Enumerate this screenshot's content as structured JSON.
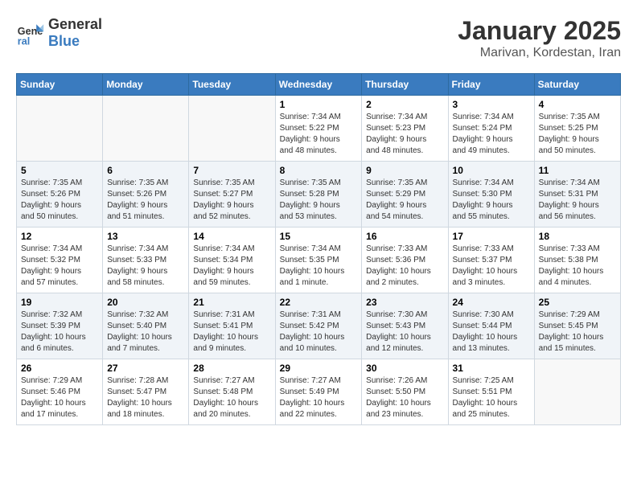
{
  "header": {
    "logo_line1": "General",
    "logo_line2": "Blue",
    "title": "January 2025",
    "subtitle": "Marivan, Kordestan, Iran"
  },
  "weekdays": [
    "Sunday",
    "Monday",
    "Tuesday",
    "Wednesday",
    "Thursday",
    "Friday",
    "Saturday"
  ],
  "weeks": [
    [
      {
        "day": null,
        "info": ""
      },
      {
        "day": null,
        "info": ""
      },
      {
        "day": null,
        "info": ""
      },
      {
        "day": "1",
        "info": "Sunrise: 7:34 AM\nSunset: 5:22 PM\nDaylight: 9 hours\nand 48 minutes."
      },
      {
        "day": "2",
        "info": "Sunrise: 7:34 AM\nSunset: 5:23 PM\nDaylight: 9 hours\nand 48 minutes."
      },
      {
        "day": "3",
        "info": "Sunrise: 7:34 AM\nSunset: 5:24 PM\nDaylight: 9 hours\nand 49 minutes."
      },
      {
        "day": "4",
        "info": "Sunrise: 7:35 AM\nSunset: 5:25 PM\nDaylight: 9 hours\nand 50 minutes."
      }
    ],
    [
      {
        "day": "5",
        "info": "Sunrise: 7:35 AM\nSunset: 5:26 PM\nDaylight: 9 hours\nand 50 minutes."
      },
      {
        "day": "6",
        "info": "Sunrise: 7:35 AM\nSunset: 5:26 PM\nDaylight: 9 hours\nand 51 minutes."
      },
      {
        "day": "7",
        "info": "Sunrise: 7:35 AM\nSunset: 5:27 PM\nDaylight: 9 hours\nand 52 minutes."
      },
      {
        "day": "8",
        "info": "Sunrise: 7:35 AM\nSunset: 5:28 PM\nDaylight: 9 hours\nand 53 minutes."
      },
      {
        "day": "9",
        "info": "Sunrise: 7:35 AM\nSunset: 5:29 PM\nDaylight: 9 hours\nand 54 minutes."
      },
      {
        "day": "10",
        "info": "Sunrise: 7:34 AM\nSunset: 5:30 PM\nDaylight: 9 hours\nand 55 minutes."
      },
      {
        "day": "11",
        "info": "Sunrise: 7:34 AM\nSunset: 5:31 PM\nDaylight: 9 hours\nand 56 minutes."
      }
    ],
    [
      {
        "day": "12",
        "info": "Sunrise: 7:34 AM\nSunset: 5:32 PM\nDaylight: 9 hours\nand 57 minutes."
      },
      {
        "day": "13",
        "info": "Sunrise: 7:34 AM\nSunset: 5:33 PM\nDaylight: 9 hours\nand 58 minutes."
      },
      {
        "day": "14",
        "info": "Sunrise: 7:34 AM\nSunset: 5:34 PM\nDaylight: 9 hours\nand 59 minutes."
      },
      {
        "day": "15",
        "info": "Sunrise: 7:34 AM\nSunset: 5:35 PM\nDaylight: 10 hours\nand 1 minute."
      },
      {
        "day": "16",
        "info": "Sunrise: 7:33 AM\nSunset: 5:36 PM\nDaylight: 10 hours\nand 2 minutes."
      },
      {
        "day": "17",
        "info": "Sunrise: 7:33 AM\nSunset: 5:37 PM\nDaylight: 10 hours\nand 3 minutes."
      },
      {
        "day": "18",
        "info": "Sunrise: 7:33 AM\nSunset: 5:38 PM\nDaylight: 10 hours\nand 4 minutes."
      }
    ],
    [
      {
        "day": "19",
        "info": "Sunrise: 7:32 AM\nSunset: 5:39 PM\nDaylight: 10 hours\nand 6 minutes."
      },
      {
        "day": "20",
        "info": "Sunrise: 7:32 AM\nSunset: 5:40 PM\nDaylight: 10 hours\nand 7 minutes."
      },
      {
        "day": "21",
        "info": "Sunrise: 7:31 AM\nSunset: 5:41 PM\nDaylight: 10 hours\nand 9 minutes."
      },
      {
        "day": "22",
        "info": "Sunrise: 7:31 AM\nSunset: 5:42 PM\nDaylight: 10 hours\nand 10 minutes."
      },
      {
        "day": "23",
        "info": "Sunrise: 7:30 AM\nSunset: 5:43 PM\nDaylight: 10 hours\nand 12 minutes."
      },
      {
        "day": "24",
        "info": "Sunrise: 7:30 AM\nSunset: 5:44 PM\nDaylight: 10 hours\nand 13 minutes."
      },
      {
        "day": "25",
        "info": "Sunrise: 7:29 AM\nSunset: 5:45 PM\nDaylight: 10 hours\nand 15 minutes."
      }
    ],
    [
      {
        "day": "26",
        "info": "Sunrise: 7:29 AM\nSunset: 5:46 PM\nDaylight: 10 hours\nand 17 minutes."
      },
      {
        "day": "27",
        "info": "Sunrise: 7:28 AM\nSunset: 5:47 PM\nDaylight: 10 hours\nand 18 minutes."
      },
      {
        "day": "28",
        "info": "Sunrise: 7:27 AM\nSunset: 5:48 PM\nDaylight: 10 hours\nand 20 minutes."
      },
      {
        "day": "29",
        "info": "Sunrise: 7:27 AM\nSunset: 5:49 PM\nDaylight: 10 hours\nand 22 minutes."
      },
      {
        "day": "30",
        "info": "Sunrise: 7:26 AM\nSunset: 5:50 PM\nDaylight: 10 hours\nand 23 minutes."
      },
      {
        "day": "31",
        "info": "Sunrise: 7:25 AM\nSunset: 5:51 PM\nDaylight: 10 hours\nand 25 minutes."
      },
      {
        "day": null,
        "info": ""
      }
    ]
  ]
}
